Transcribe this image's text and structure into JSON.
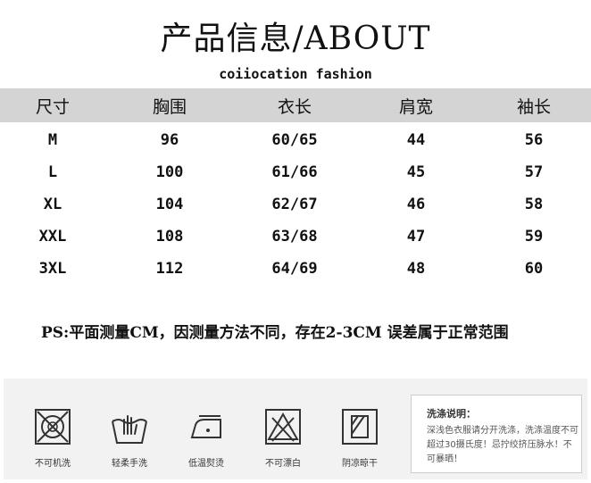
{
  "title": "产品信息/ABOUT",
  "subtitle": "coiiocation fashion",
  "table": {
    "headers": [
      "尺寸",
      "胸围",
      "衣长",
      "肩宽",
      "袖长"
    ],
    "rows": [
      [
        "M",
        "96",
        "60/65",
        "44",
        "56"
      ],
      [
        "L",
        "100",
        "61/66",
        "45",
        "57"
      ],
      [
        "XL",
        "104",
        "62/67",
        "46",
        "58"
      ],
      [
        "XXL",
        "108",
        "63/68",
        "47",
        "59"
      ],
      [
        "3XL",
        "112",
        "64/69",
        "48",
        "60"
      ]
    ]
  },
  "note": "PS:平面测量CM，因测量方法不同，存在2-3CM 误差属于正常范围",
  "care": {
    "items": [
      {
        "label": "不可机洗",
        "icon": "no-machine-wash-icon"
      },
      {
        "label": "轻柔手洗",
        "icon": "hand-wash-icon"
      },
      {
        "label": "低温熨烫",
        "icon": "low-iron-icon"
      },
      {
        "label": "不可漂白",
        "icon": "no-bleach-icon"
      },
      {
        "label": "阴凉晾干",
        "icon": "shade-dry-icon"
      }
    ],
    "wash_title": "洗涤说明：",
    "wash_text": "深浅色衣服请分开洗涤，洗涤温度不可超过30摄氏度！忌拧绞挤压脉水！不可暴晒！"
  }
}
